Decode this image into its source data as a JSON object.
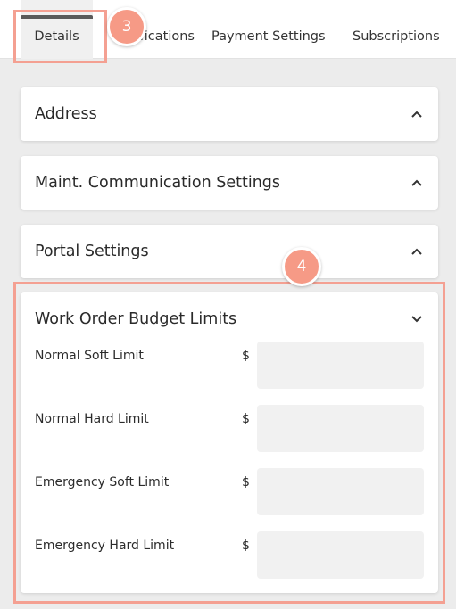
{
  "tabs": [
    {
      "label": "Details"
    },
    {
      "label": "Notifications"
    },
    {
      "label": "Payment Settings"
    },
    {
      "label": "Subscriptions"
    }
  ],
  "callouts": [
    "3",
    "4"
  ],
  "sections": [
    {
      "title": "Address",
      "state": "collapsed"
    },
    {
      "title": "Maint. Communication Settings",
      "state": "collapsed"
    },
    {
      "title": "Portal Settings",
      "state": "collapsed"
    }
  ],
  "budget": {
    "title": "Work Order Budget Limits",
    "state": "expanded",
    "rows": [
      {
        "label": "Normal Soft Limit",
        "currency": "$",
        "value": ""
      },
      {
        "label": "Normal Hard Limit",
        "currency": "$",
        "value": ""
      },
      {
        "label": "Emergency Soft Limit",
        "currency": "$",
        "value": ""
      },
      {
        "label": "Emergency Hard Limit",
        "currency": "$",
        "value": ""
      }
    ]
  },
  "colors": {
    "callout_fill": "#f69a86",
    "callout_border": "#f4a092",
    "active_tab_indicator": "#5a5a5a"
  }
}
